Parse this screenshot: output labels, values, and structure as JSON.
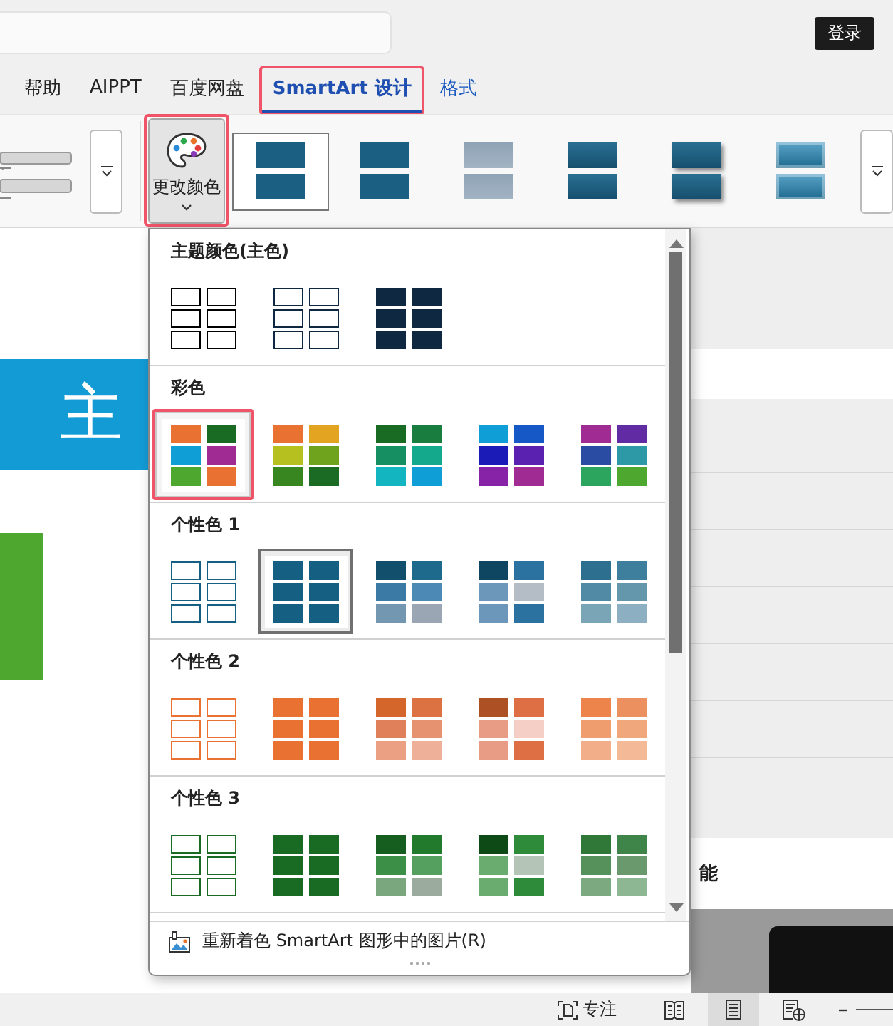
{
  "top_bar": {
    "login_button": "登录"
  },
  "tabs": [
    {
      "label": "帮助",
      "selected": false,
      "contextual": false,
      "highlighted": false
    },
    {
      "label": "AIPPT",
      "selected": false,
      "contextual": false,
      "highlighted": false
    },
    {
      "label": "百度网盘",
      "selected": false,
      "contextual": false,
      "highlighted": false
    },
    {
      "label": "SmartArt 设计",
      "selected": true,
      "contextual": true,
      "highlighted": true
    },
    {
      "label": "格式",
      "selected": false,
      "contextual": true,
      "highlighted": false
    }
  ],
  "ribbon": {
    "change_colors_button": {
      "label": "更改颜色",
      "highlighted": true
    },
    "styles": [
      {
        "kind": "flat",
        "selected": true
      },
      {
        "kind": "flat",
        "selected": false
      },
      {
        "kind": "faded",
        "selected": false
      },
      {
        "kind": "gradient",
        "selected": false
      },
      {
        "kind": "shadow",
        "selected": false
      },
      {
        "kind": "bevel",
        "selected": false
      }
    ]
  },
  "slide": {
    "banner_text": "主"
  },
  "side_panel": {
    "heading": "能"
  },
  "color_menu": {
    "sections": [
      {
        "title": "主题颜色(主色)",
        "options": [
          {
            "kind": "outline",
            "selected": false,
            "highlighted": false,
            "cells": [
              {
                "color": "#000000"
              },
              {
                "color": "#000000"
              },
              {
                "color": "#000000"
              },
              {
                "color": "#000000"
              },
              {
                "color": "#000000"
              },
              {
                "color": "#000000"
              }
            ]
          },
          {
            "kind": "outline",
            "selected": false,
            "highlighted": false,
            "cells": [
              {
                "color": "#0e2841"
              },
              {
                "color": "#0e2841"
              },
              {
                "color": "#0e2841"
              },
              {
                "color": "#0e2841"
              },
              {
                "color": "#0e2841"
              },
              {
                "color": "#0e2841"
              }
            ]
          },
          {
            "kind": "fill",
            "selected": false,
            "highlighted": false,
            "cells": [
              {
                "color": "#0e2841"
              },
              {
                "color": "#0e2841"
              },
              {
                "color": "#0e2841"
              },
              {
                "color": "#0e2841"
              },
              {
                "color": "#0e2841"
              },
              {
                "color": "#0e2841"
              }
            ]
          }
        ]
      },
      {
        "title": "彩色",
        "options": [
          {
            "kind": "fill",
            "selected": false,
            "highlighted": true,
            "cells": [
              {
                "color": "#e97132"
              },
              {
                "color": "#196b24"
              },
              {
                "color": "#0f9ed5"
              },
              {
                "color": "#a02b93"
              },
              {
                "color": "#4ea72e"
              },
              {
                "color": "#e97132"
              }
            ]
          },
          {
            "kind": "fill",
            "selected": false,
            "highlighted": false,
            "cells": [
              {
                "color": "#e97132"
              },
              {
                "color": "#e3a521"
              },
              {
                "color": "#b6c11f"
              },
              {
                "color": "#6fa31e"
              },
              {
                "color": "#37861f"
              },
              {
                "color": "#1b6b24"
              }
            ]
          },
          {
            "kind": "fill",
            "selected": false,
            "highlighted": false,
            "cells": [
              {
                "color": "#196b24"
              },
              {
                "color": "#187d3f"
              },
              {
                "color": "#169062"
              },
              {
                "color": "#14a88c"
              },
              {
                "color": "#12b5c0"
              },
              {
                "color": "#0f9ed5"
              }
            ]
          },
          {
            "kind": "fill",
            "selected": false,
            "highlighted": false,
            "cells": [
              {
                "color": "#0f9ed5"
              },
              {
                "color": "#1658c6"
              },
              {
                "color": "#1b1bb8"
              },
              {
                "color": "#5a21b0"
              },
              {
                "color": "#8623a6"
              },
              {
                "color": "#a02b93"
              }
            ]
          },
          {
            "kind": "fill",
            "selected": false,
            "highlighted": false,
            "cells": [
              {
                "color": "#a02b93"
              },
              {
                "color": "#612ca3"
              },
              {
                "color": "#2b4ca3"
              },
              {
                "color": "#2d98a6"
              },
              {
                "color": "#2ca55f"
              },
              {
                "color": "#4ea72e"
              }
            ]
          }
        ]
      },
      {
        "title": "个性色 1",
        "options": [
          {
            "kind": "outline",
            "selected": false,
            "highlighted": false,
            "cells": [
              {
                "color": "#156082"
              },
              {
                "color": "#156082"
              },
              {
                "color": "#156082"
              },
              {
                "color": "#156082"
              },
              {
                "color": "#156082"
              },
              {
                "color": "#156082"
              }
            ]
          },
          {
            "kind": "fill",
            "selected": true,
            "highlighted": false,
            "cells": [
              {
                "color": "#156082"
              },
              {
                "color": "#156082"
              },
              {
                "color": "#156082"
              },
              {
                "color": "#156082"
              },
              {
                "color": "#156082"
              },
              {
                "color": "#156082"
              }
            ]
          },
          {
            "kind": "fill",
            "selected": false,
            "highlighted": false,
            "cells": [
              {
                "color": "#124f6c"
              },
              {
                "color": "#1d6a8c"
              },
              {
                "color": "#3a7aa5"
              },
              {
                "color": "#4d89b5"
              },
              {
                "color": "#7497b1"
              },
              {
                "color": "#9aa6b3"
              }
            ]
          },
          {
            "kind": "fill",
            "selected": false,
            "highlighted": false,
            "cells": [
              {
                "color": "#0e4560"
              },
              {
                "color": "#2c72a0"
              },
              {
                "color": "#6c97ba"
              },
              {
                "color": "#b4bcc5"
              },
              {
                "color": "#6c97ba"
              },
              {
                "color": "#2c72a0"
              }
            ]
          },
          {
            "kind": "fill",
            "selected": false,
            "highlighted": false,
            "cells": [
              {
                "color": "#2d6f8e"
              },
              {
                "color": "#3e7f9d"
              },
              {
                "color": "#518aa4"
              },
              {
                "color": "#6597ac"
              },
              {
                "color": "#79a5b7"
              },
              {
                "color": "#8cb0c1"
              }
            ]
          }
        ]
      },
      {
        "title": "个性色 2",
        "options": [
          {
            "kind": "outline",
            "selected": false,
            "highlighted": false,
            "cells": [
              {
                "color": "#e97132"
              },
              {
                "color": "#e97132"
              },
              {
                "color": "#e97132"
              },
              {
                "color": "#e97132"
              },
              {
                "color": "#e97132"
              },
              {
                "color": "#e97132"
              }
            ]
          },
          {
            "kind": "fill",
            "selected": false,
            "highlighted": false,
            "cells": [
              {
                "color": "#e97132"
              },
              {
                "color": "#e97132"
              },
              {
                "color": "#e97132"
              },
              {
                "color": "#e97132"
              },
              {
                "color": "#e97132"
              },
              {
                "color": "#e97132"
              }
            ]
          },
          {
            "kind": "fill",
            "selected": false,
            "highlighted": false,
            "cells": [
              {
                "color": "#d4652b"
              },
              {
                "color": "#dc7242"
              },
              {
                "color": "#e0805a"
              },
              {
                "color": "#e6916f"
              },
              {
                "color": "#eca083"
              },
              {
                "color": "#efb09a"
              }
            ]
          },
          {
            "kind": "fill",
            "selected": false,
            "highlighted": false,
            "cells": [
              {
                "color": "#ad5023"
              },
              {
                "color": "#de6e43"
              },
              {
                "color": "#e99c85"
              },
              {
                "color": "#f5cfc5"
              },
              {
                "color": "#e99c85"
              },
              {
                "color": "#de6e43"
              }
            ]
          },
          {
            "kind": "fill",
            "selected": false,
            "highlighted": false,
            "cells": [
              {
                "color": "#ec844b"
              },
              {
                "color": "#ed9060"
              },
              {
                "color": "#ef9c6e"
              },
              {
                "color": "#f0a77c"
              },
              {
                "color": "#f2ae88"
              },
              {
                "color": "#f4ba98"
              }
            ]
          }
        ]
      },
      {
        "title": "个性色 3",
        "options": [
          {
            "kind": "outline",
            "selected": false,
            "highlighted": false,
            "cells": [
              {
                "color": "#196b24"
              },
              {
                "color": "#196b24"
              },
              {
                "color": "#196b24"
              },
              {
                "color": "#196b24"
              },
              {
                "color": "#196b24"
              },
              {
                "color": "#196b24"
              }
            ]
          },
          {
            "kind": "fill",
            "selected": false,
            "highlighted": false,
            "cells": [
              {
                "color": "#196b24"
              },
              {
                "color": "#196b24"
              },
              {
                "color": "#196b24"
              },
              {
                "color": "#196b24"
              },
              {
                "color": "#196b24"
              },
              {
                "color": "#196b24"
              }
            ]
          },
          {
            "kind": "fill",
            "selected": false,
            "highlighted": false,
            "cells": [
              {
                "color": "#155e20"
              },
              {
                "color": "#227a2d"
              },
              {
                "color": "#3b8f46"
              },
              {
                "color": "#55a05e"
              },
              {
                "color": "#7ba77f"
              },
              {
                "color": "#9bac9e"
              }
            ]
          },
          {
            "kind": "fill",
            "selected": false,
            "highlighted": false,
            "cells": [
              {
                "color": "#0d4a16"
              },
              {
                "color": "#2e8b3a"
              },
              {
                "color": "#6aac70"
              },
              {
                "color": "#b4c4b6"
              },
              {
                "color": "#6aac70"
              },
              {
                "color": "#2e8b3a"
              }
            ]
          },
          {
            "kind": "fill",
            "selected": false,
            "highlighted": false,
            "cells": [
              {
                "color": "#2f7838"
              },
              {
                "color": "#3f8448"
              },
              {
                "color": "#56915c"
              },
              {
                "color": "#69996d"
              },
              {
                "color": "#7ca97f"
              },
              {
                "color": "#8db792"
              }
            ]
          }
        ]
      }
    ],
    "footer": "重新着色 SmartArt 图形中的图片(R)"
  },
  "status_bar": {
    "focus": "专注",
    "views": [
      {
        "kind": "reading",
        "selected": false
      },
      {
        "kind": "normal",
        "selected": true
      },
      {
        "kind": "web",
        "selected": false
      }
    ]
  }
}
